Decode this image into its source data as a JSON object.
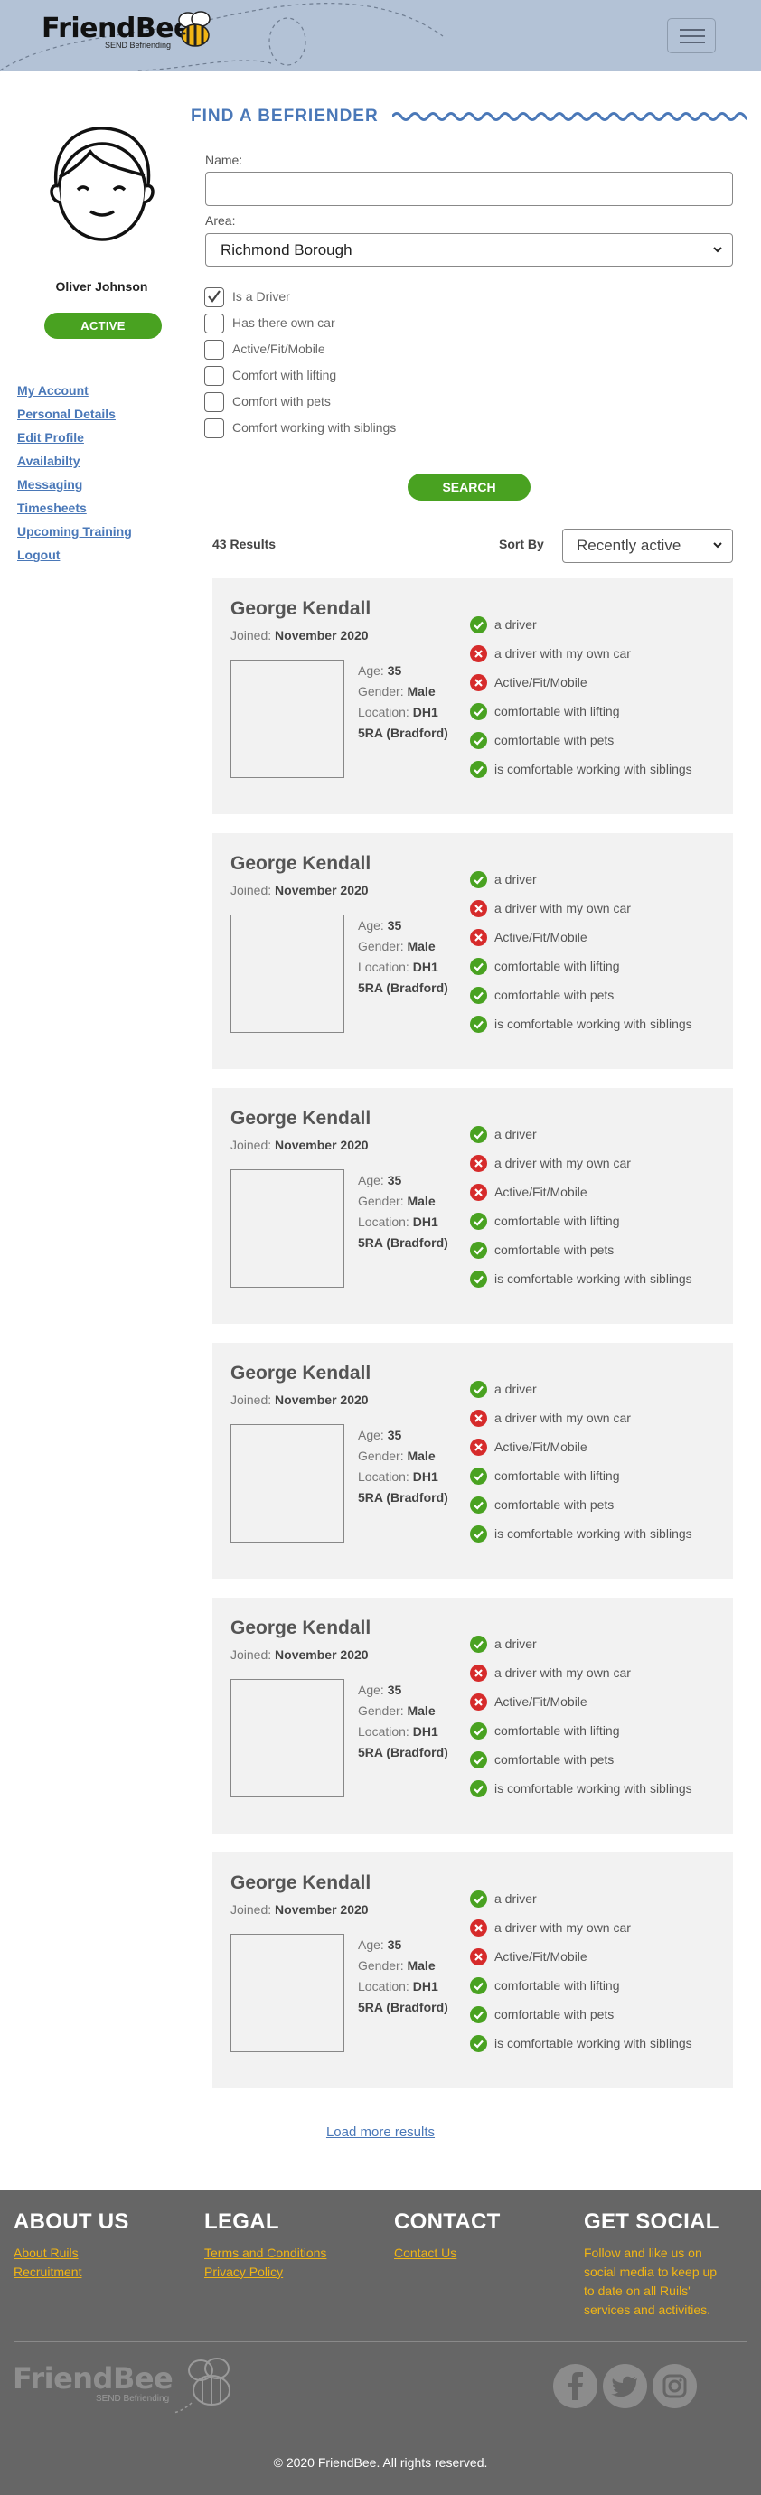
{
  "header": {
    "logo_text": "FriendBee",
    "logo_sub": "SEND Befriending",
    "menu_icon": "hamburger-icon"
  },
  "profile": {
    "name": "Oliver Johnson",
    "status": "ACTIVE"
  },
  "side_nav": [
    {
      "label": "My Account"
    },
    {
      "label": "Personal Details"
    },
    {
      "label": "Edit Profile"
    },
    {
      "label": "Availabilty"
    },
    {
      "label": "Messaging"
    },
    {
      "label": "Timesheets"
    },
    {
      "label": "Upcoming Training"
    },
    {
      "label": "Logout"
    }
  ],
  "find": {
    "title": "FIND A BEFRIENDER",
    "name_label": "Name:",
    "name_value": "",
    "area_label": "Area:",
    "area_value": "Richmond Borough",
    "checkboxes": [
      {
        "label": "Is a Driver",
        "checked": true
      },
      {
        "label": "Has there own car",
        "checked": false
      },
      {
        "label": "Active/Fit/Mobile",
        "checked": false
      },
      {
        "label": "Comfort with lifting",
        "checked": false
      },
      {
        "label": "Comfort with pets",
        "checked": false
      },
      {
        "label": "Comfort working with siblings",
        "checked": false
      }
    ],
    "search_label": "SEARCH"
  },
  "results": {
    "count_text": "43 Results",
    "sort_label": "Sort By",
    "sort_value": "Recently active",
    "load_more": "Load more results",
    "cards": [
      {
        "name": "George Kendall",
        "joined_label": "Joined:",
        "joined": "November 2020",
        "age_label": "Age:",
        "age": "35",
        "gender_label": "Gender:",
        "gender": "Male",
        "location_label": "Location:",
        "location": "DH1 5RA (Bradford)",
        "attrs": [
          {
            "label": "a driver",
            "ok": true
          },
          {
            "label": "a driver with my own car",
            "ok": false
          },
          {
            "label": "Active/Fit/Mobile",
            "ok": false
          },
          {
            "label": "comfortable with lifting",
            "ok": true
          },
          {
            "label": "comfortable with pets",
            "ok": true
          },
          {
            "label": "is comfortable working with siblings",
            "ok": true
          }
        ]
      },
      {
        "name": "George Kendall",
        "joined_label": "Joined:",
        "joined": "November 2020",
        "age_label": "Age:",
        "age": "35",
        "gender_label": "Gender:",
        "gender": "Male",
        "location_label": "Location:",
        "location": "DH1 5RA (Bradford)",
        "attrs": [
          {
            "label": "a driver",
            "ok": true
          },
          {
            "label": "a driver with my own car",
            "ok": false
          },
          {
            "label": "Active/Fit/Mobile",
            "ok": false
          },
          {
            "label": "comfortable with lifting",
            "ok": true
          },
          {
            "label": "comfortable with pets",
            "ok": true
          },
          {
            "label": "is comfortable working with siblings",
            "ok": true
          }
        ]
      },
      {
        "name": "George Kendall",
        "joined_label": "Joined:",
        "joined": "November 2020",
        "age_label": "Age:",
        "age": "35",
        "gender_label": "Gender:",
        "gender": "Male",
        "location_label": "Location:",
        "location": "DH1 5RA (Bradford)",
        "attrs": [
          {
            "label": "a driver",
            "ok": true
          },
          {
            "label": "a driver with my own car",
            "ok": false
          },
          {
            "label": "Active/Fit/Mobile",
            "ok": false
          },
          {
            "label": "comfortable with lifting",
            "ok": true
          },
          {
            "label": "comfortable with pets",
            "ok": true
          },
          {
            "label": "is comfortable working with siblings",
            "ok": true
          }
        ]
      },
      {
        "name": "George Kendall",
        "joined_label": "Joined:",
        "joined": "November 2020",
        "age_label": "Age:",
        "age": "35",
        "gender_label": "Gender:",
        "gender": "Male",
        "location_label": "Location:",
        "location": "DH1 5RA (Bradford)",
        "attrs": [
          {
            "label": "a driver",
            "ok": true
          },
          {
            "label": "a driver with my own car",
            "ok": false
          },
          {
            "label": "Active/Fit/Mobile",
            "ok": false
          },
          {
            "label": "comfortable with lifting",
            "ok": true
          },
          {
            "label": "comfortable with pets",
            "ok": true
          },
          {
            "label": "is comfortable working with siblings",
            "ok": true
          }
        ]
      },
      {
        "name": "George Kendall",
        "joined_label": "Joined:",
        "joined": "November 2020",
        "age_label": "Age:",
        "age": "35",
        "gender_label": "Gender:",
        "gender": "Male",
        "location_label": "Location:",
        "location": "DH1 5RA (Bradford)",
        "attrs": [
          {
            "label": "a driver",
            "ok": true
          },
          {
            "label": "a driver with my own car",
            "ok": false
          },
          {
            "label": "Active/Fit/Mobile",
            "ok": false
          },
          {
            "label": "comfortable with lifting",
            "ok": true
          },
          {
            "label": "comfortable with pets",
            "ok": true
          },
          {
            "label": "is comfortable working with siblings",
            "ok": true
          }
        ]
      },
      {
        "name": "George Kendall",
        "joined_label": "Joined:",
        "joined": "November 2020",
        "age_label": "Age:",
        "age": "35",
        "gender_label": "Gender:",
        "gender": "Male",
        "location_label": "Location:",
        "location": "DH1 5RA (Bradford)",
        "attrs": [
          {
            "label": "a driver",
            "ok": true
          },
          {
            "label": "a driver with my own car",
            "ok": false
          },
          {
            "label": "Active/Fit/Mobile",
            "ok": false
          },
          {
            "label": "comfortable with lifting",
            "ok": true
          },
          {
            "label": "comfortable with pets",
            "ok": true
          },
          {
            "label": "is comfortable working with siblings",
            "ok": true
          }
        ]
      }
    ]
  },
  "footer": {
    "about": {
      "heading": "ABOUT US",
      "links": [
        "About Ruils",
        "Recruitment"
      ]
    },
    "legal": {
      "heading": "LEGAL",
      "links": [
        "Terms and Conditions",
        "Privacy Policy"
      ]
    },
    "contact": {
      "heading": "CONTACT",
      "links": [
        "Contact Us"
      ]
    },
    "social": {
      "heading": "GET SOCIAL",
      "text": "Follow and like us on social media to keep up to date on all Ruils' services and activities."
    },
    "logo_text": "FriendBee",
    "logo_sub": "SEND Befriending",
    "social_icons": [
      "facebook-icon",
      "twitter-icon",
      "instagram-icon"
    ],
    "copyright": "© 2020 FriendBee. All rights reserved."
  },
  "colors": {
    "header_bg": "#b3c2d6",
    "accent_blue": "#4a78b8",
    "active_green": "#49a221",
    "error_red": "#d62b2b",
    "footer_bg": "#666666",
    "footer_link": "#f1b514"
  }
}
